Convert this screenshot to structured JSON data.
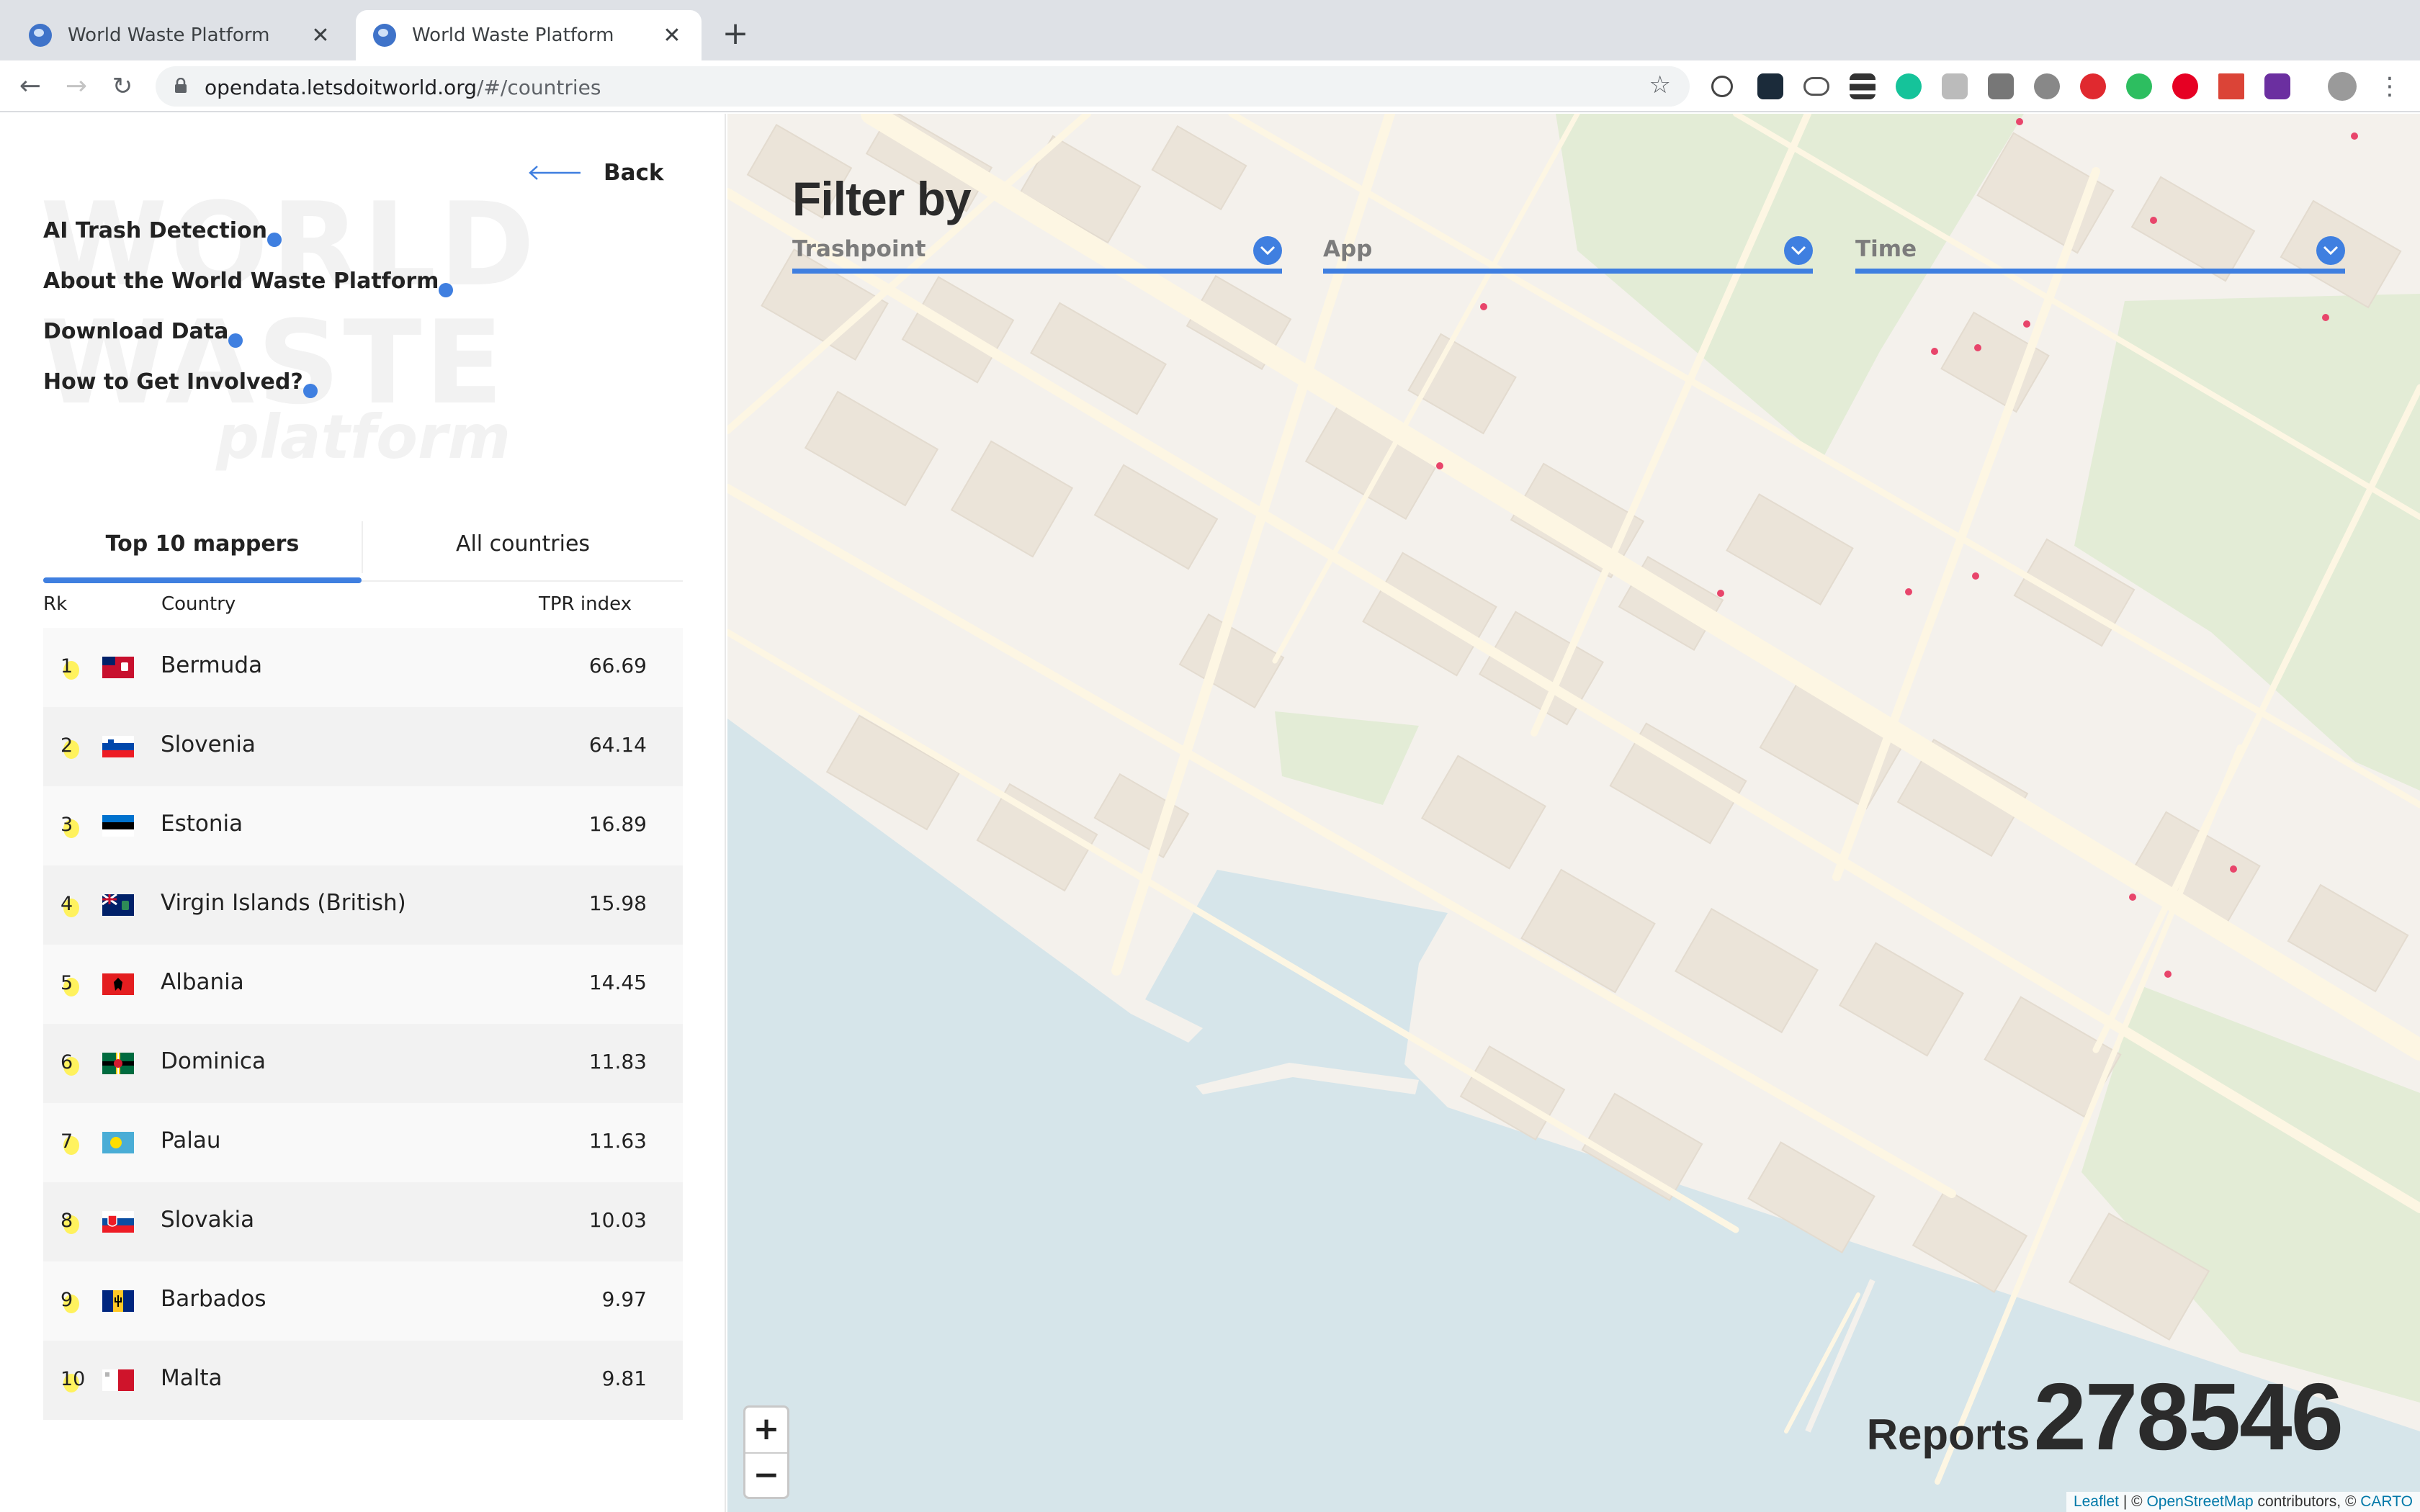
{
  "browser": {
    "tabs": [
      {
        "title": "World Waste Platform",
        "active": false
      },
      {
        "title": "World Waste Platform",
        "active": true
      }
    ],
    "url_host": "opendata.letsdoitworld.org",
    "url_path": "/#/countries"
  },
  "sidebar": {
    "back_label": "Back",
    "watermark_line1": "WORLD",
    "watermark_line2": "WASTE",
    "watermark_line3": "platform",
    "menu": [
      {
        "label": "AI Trash Detection"
      },
      {
        "label": "About the World Waste Platform"
      },
      {
        "label": "Download Data"
      },
      {
        "label": "How to Get Involved?"
      }
    ],
    "tabs": [
      {
        "label": "Top 10 mappers",
        "active": true
      },
      {
        "label": "All countries",
        "active": false
      }
    ],
    "columns": {
      "rank": "Rk",
      "country": "Country",
      "index": "TPR index"
    },
    "rows": [
      {
        "rank": "1",
        "country": "Bermuda",
        "value": "66.69",
        "flag": "bermuda-flag"
      },
      {
        "rank": "2",
        "country": "Slovenia",
        "value": "64.14",
        "flag": "slovenia-flag"
      },
      {
        "rank": "3",
        "country": "Estonia",
        "value": "16.89",
        "flag": "estonia-flag"
      },
      {
        "rank": "4",
        "country": "Virgin Islands (British)",
        "value": "15.98",
        "flag": "bvi-flag"
      },
      {
        "rank": "5",
        "country": "Albania",
        "value": "14.45",
        "flag": "albania-flag"
      },
      {
        "rank": "6",
        "country": "Dominica",
        "value": "11.83",
        "flag": "dominica-flag"
      },
      {
        "rank": "7",
        "country": "Palau",
        "value": "11.63",
        "flag": "palau-flag"
      },
      {
        "rank": "8",
        "country": "Slovakia",
        "value": "10.03",
        "flag": "slovakia-flag"
      },
      {
        "rank": "9",
        "country": "Barbados",
        "value": "9.97",
        "flag": "barbados-flag"
      },
      {
        "rank": "10",
        "country": "Malta",
        "value": "9.81",
        "flag": "malta-flag"
      }
    ]
  },
  "map": {
    "filter_title": "Filter by",
    "filters": [
      {
        "label": "Trashpoint"
      },
      {
        "label": "App"
      },
      {
        "label": "Time"
      }
    ],
    "zoom_in": "+",
    "zoom_out": "−",
    "reports_label": "Reports",
    "reports_count": "278546",
    "attribution": {
      "leaflet": "Leaflet",
      "sep": " | © ",
      "osm": "OpenStreetMap",
      "contrib": " contributors, © ",
      "carto": "CARTO"
    }
  },
  "colors": {
    "accent": "#3f7fe0",
    "marker": "#e8456b",
    "water": "#d6e5ea",
    "park": "#e3ecd6"
  }
}
